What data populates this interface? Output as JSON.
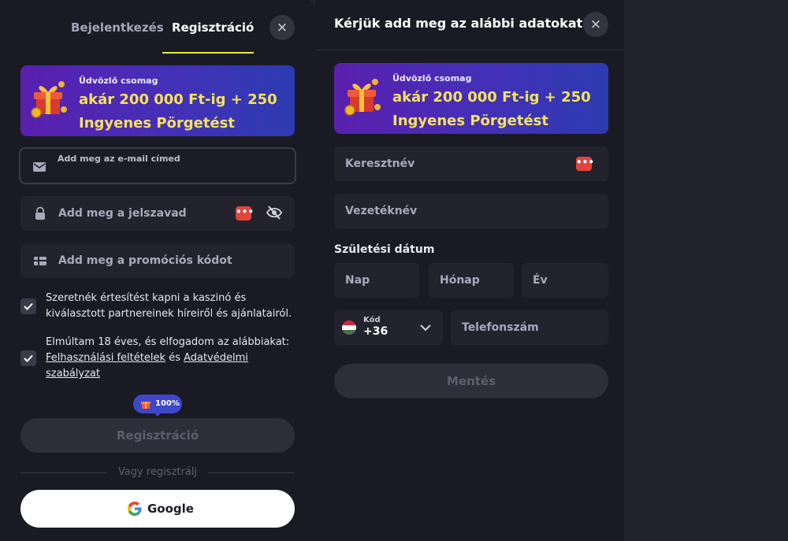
{
  "left_panel": {
    "tabs": {
      "login": "Bejelentkezés",
      "register": "Regisztráció"
    },
    "close_icon": "×",
    "promo": {
      "small": "Üdvözlő csomag",
      "line1": "akár 200 000 Ft-ig + 250",
      "line2": "Ingyenes Pörgetést"
    },
    "email": {
      "label": "Add meg az e-mail címed"
    },
    "password": {
      "placeholder": "Add meg a jelszavad",
      "badge": "•••"
    },
    "promo_code": {
      "placeholder": "Add meg a promóciós kódot"
    },
    "consent_news": {
      "line1": "Szeretnék értesítést kapni a kaszinó és",
      "line2": "kiválasztott partnereinek híreiről és ajánlatairól."
    },
    "consent_terms": {
      "line1": "Elmúltam 18 éves, és elfogadom az alábbiakat:",
      "terms_link": "Felhasználási feltételek",
      "and": "és",
      "privacy_link_a": "Adatvédelmi",
      "privacy_link_b": "szabályzat"
    },
    "progress_badge": "100%",
    "register_button": "Regisztráció",
    "divider_text": "Vagy regisztrálj",
    "google_button": "Google"
  },
  "right_panel": {
    "title": "Kérjük add meg az alábbi adatokat!",
    "close_icon": "×",
    "promo": {
      "small": "Üdvözlő csomag",
      "line1": "akár 200 000 Ft-ig + 250",
      "line2": "Ingyenes Pörgetést"
    },
    "first_name": {
      "placeholder": "Keresztnév",
      "badge": "•••"
    },
    "last_name": {
      "placeholder": "Vezetéknév"
    },
    "dob": {
      "label": "Születési dátum",
      "day": "Nap",
      "month": "Hónap",
      "year": "Év"
    },
    "phone": {
      "code_label": "Kód",
      "code_value": "+36",
      "placeholder": "Telefonszám"
    },
    "save_button": "Mentés"
  },
  "colors": {
    "accent_underline": "#e4f23c",
    "promo_text": "#f4e25d",
    "badge_red": "#e0443a",
    "badge_blue": "#3d47c8"
  }
}
